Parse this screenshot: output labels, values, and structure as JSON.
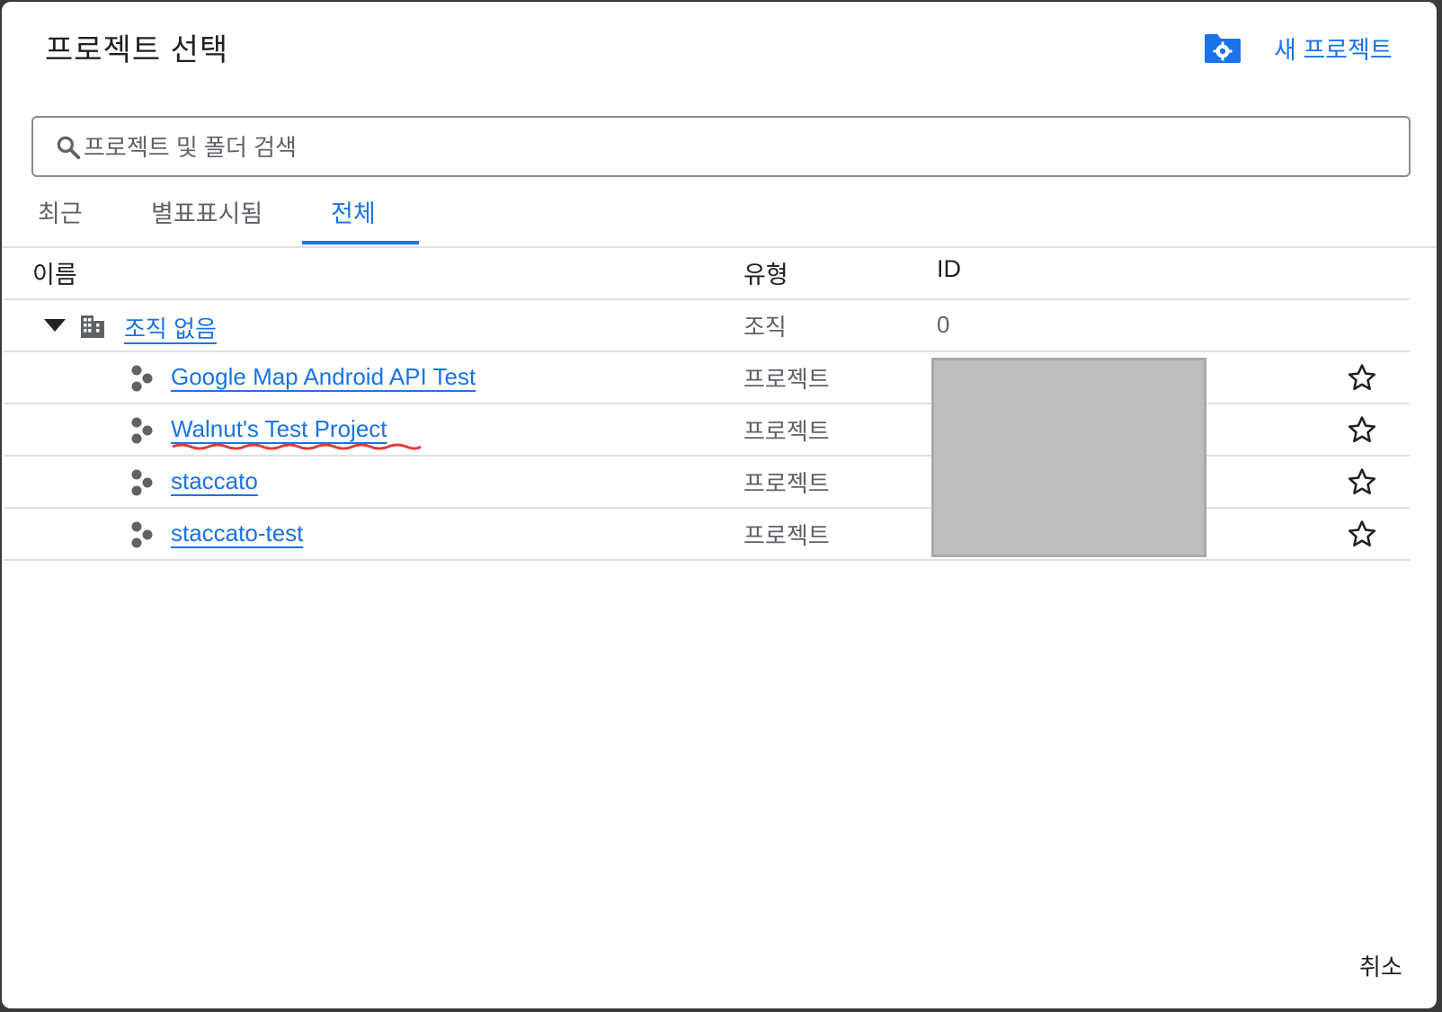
{
  "dialog": {
    "title": "프로젝트 선택",
    "new_project_label": "새 프로젝트",
    "folder_icon": "folder-settings-icon",
    "cancel_label": "취소"
  },
  "search": {
    "placeholder": "프로젝트 및 폴더 검색",
    "value": ""
  },
  "tabs": [
    {
      "label": "최근",
      "active": false
    },
    {
      "label": "별표표시됨",
      "active": false
    },
    {
      "label": "전체",
      "active": true
    }
  ],
  "table": {
    "headers": {
      "name": "이름",
      "type": "유형",
      "id": "ID"
    },
    "org_row": {
      "name": "조직 없음",
      "type": "조직",
      "id": "0",
      "expanded": true
    },
    "projects": [
      {
        "name": "Google Map Android API Test",
        "type": "프로젝트",
        "starred": false
      },
      {
        "name": "Walnut's Test Project",
        "type": "프로젝트",
        "starred": false
      },
      {
        "name": "staccato",
        "type": "프로젝트",
        "starred": false
      },
      {
        "name": "staccato-test",
        "type": "프로젝트",
        "starred": false
      }
    ]
  },
  "colors": {
    "accent": "#1a73e8",
    "text": "#202124",
    "muted": "#5f6368",
    "divider": "#e0e0e0",
    "redaction": "#bdbdbd",
    "annotation": "#e53935"
  }
}
